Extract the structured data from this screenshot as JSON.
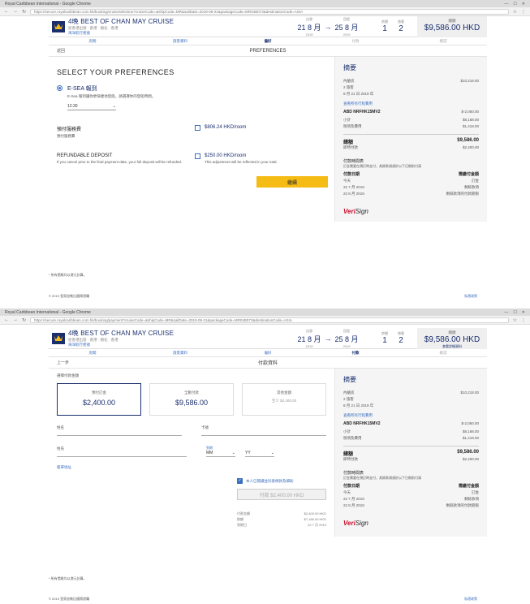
{
  "browser": {
    "title_top": "Royal Caribbean International - Google Chrome",
    "title_bot": "Royal Caribbean International - Google Chrome",
    "url_top": "https://secure.royalcaribbean.com.hk/booking/cruiseSelection?cruiseCode=&shipCode=MR&sailDate=2019-08-21&packageCode=MR04B073&destinationCode=ASIA",
    "url_bot": "https://secure.royalcaribbean.com.hk/booking/payment?cruiseCode=&shipCode=MR&sailDate=2019-08-21&packageCode=MR04B073&destinationCode=ASIA"
  },
  "header": {
    "title": "4晚 BEST OF CHAN MAY CRUISE",
    "subtitle": "從香港出發 · 香港 · 順化 · 香港",
    "ship": "海洋航行者號",
    "depart_label": "出發",
    "depart_value": "21 8 月",
    "depart_year": "2019",
    "return_label": "回程",
    "return_value": "25 8 月",
    "return_year": "2019",
    "rooms_label": "房間",
    "rooms_value": "1",
    "guests_label": "旅客",
    "guests_value": "2",
    "total_label": "總額",
    "total_value": "$9,586.00 HKD",
    "total_sub": "查看詳細資料"
  },
  "steps": [
    "房間",
    "旅客資料",
    "偏好",
    "付款",
    "確認"
  ],
  "top": {
    "back": "返回",
    "section": "PREFERENCES",
    "title": "SELECT YOUR PREFERENCES",
    "esea_title": "E-SEA 報到",
    "esea_desc": "E-Sea 報到讓你更快捷地登船，請選擇你的登船時間。",
    "time_value": "12:30",
    "prepaid_title": "預付服務費",
    "prepaid_desc": "預付服務費",
    "prepaid_price": "$806.24 HKD/room",
    "refund_title": "REFUNDABLE DEPOSIT",
    "refund_desc": "If you cancel prior to the final payment date, your full deposit will be refunded.",
    "refund_price": "$250.00 HKD/room",
    "refund_note": "This adjustment will be reflected in your total.",
    "continue": "繼續"
  },
  "sidebar": {
    "title": "摘要",
    "room_label": "內艙房",
    "room_desc": "2 旅客",
    "room_date": "8 月 21 日 2019 年",
    "room_price": "$10,218.00",
    "link": "查看所有行程費用",
    "promo_code": "ABD NRFHK15MV2",
    "promo_value": "$-2,050.00",
    "fare_label": "小計",
    "fare_value": "$8,168.00",
    "tax_label": "稅項及費用",
    "tax_value": "$1,418.00",
    "total_label": "總額",
    "total_value": "$9,586.00",
    "due_label": "即時付款",
    "due_value": "$2,400.00",
    "sched_title": "付款時間表",
    "sched_desc": "訂金需要在預訂時支付，其餘款項須於以下日期前付清",
    "sched_h1": "付款日期",
    "sched_h2": "需繳付金額",
    "sched_r1_date": "今天",
    "sched_r1_amt": "訂金",
    "sched_r2_date": "22 7 月 2019",
    "sched_r2_amt": "剩餘款項",
    "sched_r3_date": "22 8 月 2019",
    "sched_r3_amt": "剩餘款項的付款期限",
    "verisign_a": "Veri",
    "verisign_b": "Sign"
  },
  "bottom": {
    "back": "上一步",
    "section": "付款資料",
    "choose_label": "選擇付款金額",
    "box1_label": "預付訂金",
    "box1_value": "$2,400.00",
    "box2_label": "全數付款",
    "box2_value": "$9,586.00",
    "box3_label": "其他金額",
    "box3_value": "至少 $2,400.00",
    "card_name": "姓名",
    "card_last": "姓氏",
    "card_number": "卡號",
    "expiry_label": "到期",
    "expiry_mm": "MM",
    "expiry_yy": "YY",
    "billing_link": "帳單地址",
    "agree": "本人已閱讀並同意條款及細則",
    "pay_button": "付款 $2,400.00 HKD",
    "summ_r1_label": "付款金額",
    "summ_r1_value": "$2,400.00 HKD",
    "summ_r2_label": "餘額",
    "summ_r2_value": "$7,186.00 HKD",
    "summ_r3_label": "到期日",
    "summ_r3_value": "22 7 月 2019"
  },
  "footer": {
    "note": "* 所有價格均以港元計算。",
    "copyright": "© 2019 皇家加勒比國際遊輪",
    "link": "私隱政策"
  }
}
